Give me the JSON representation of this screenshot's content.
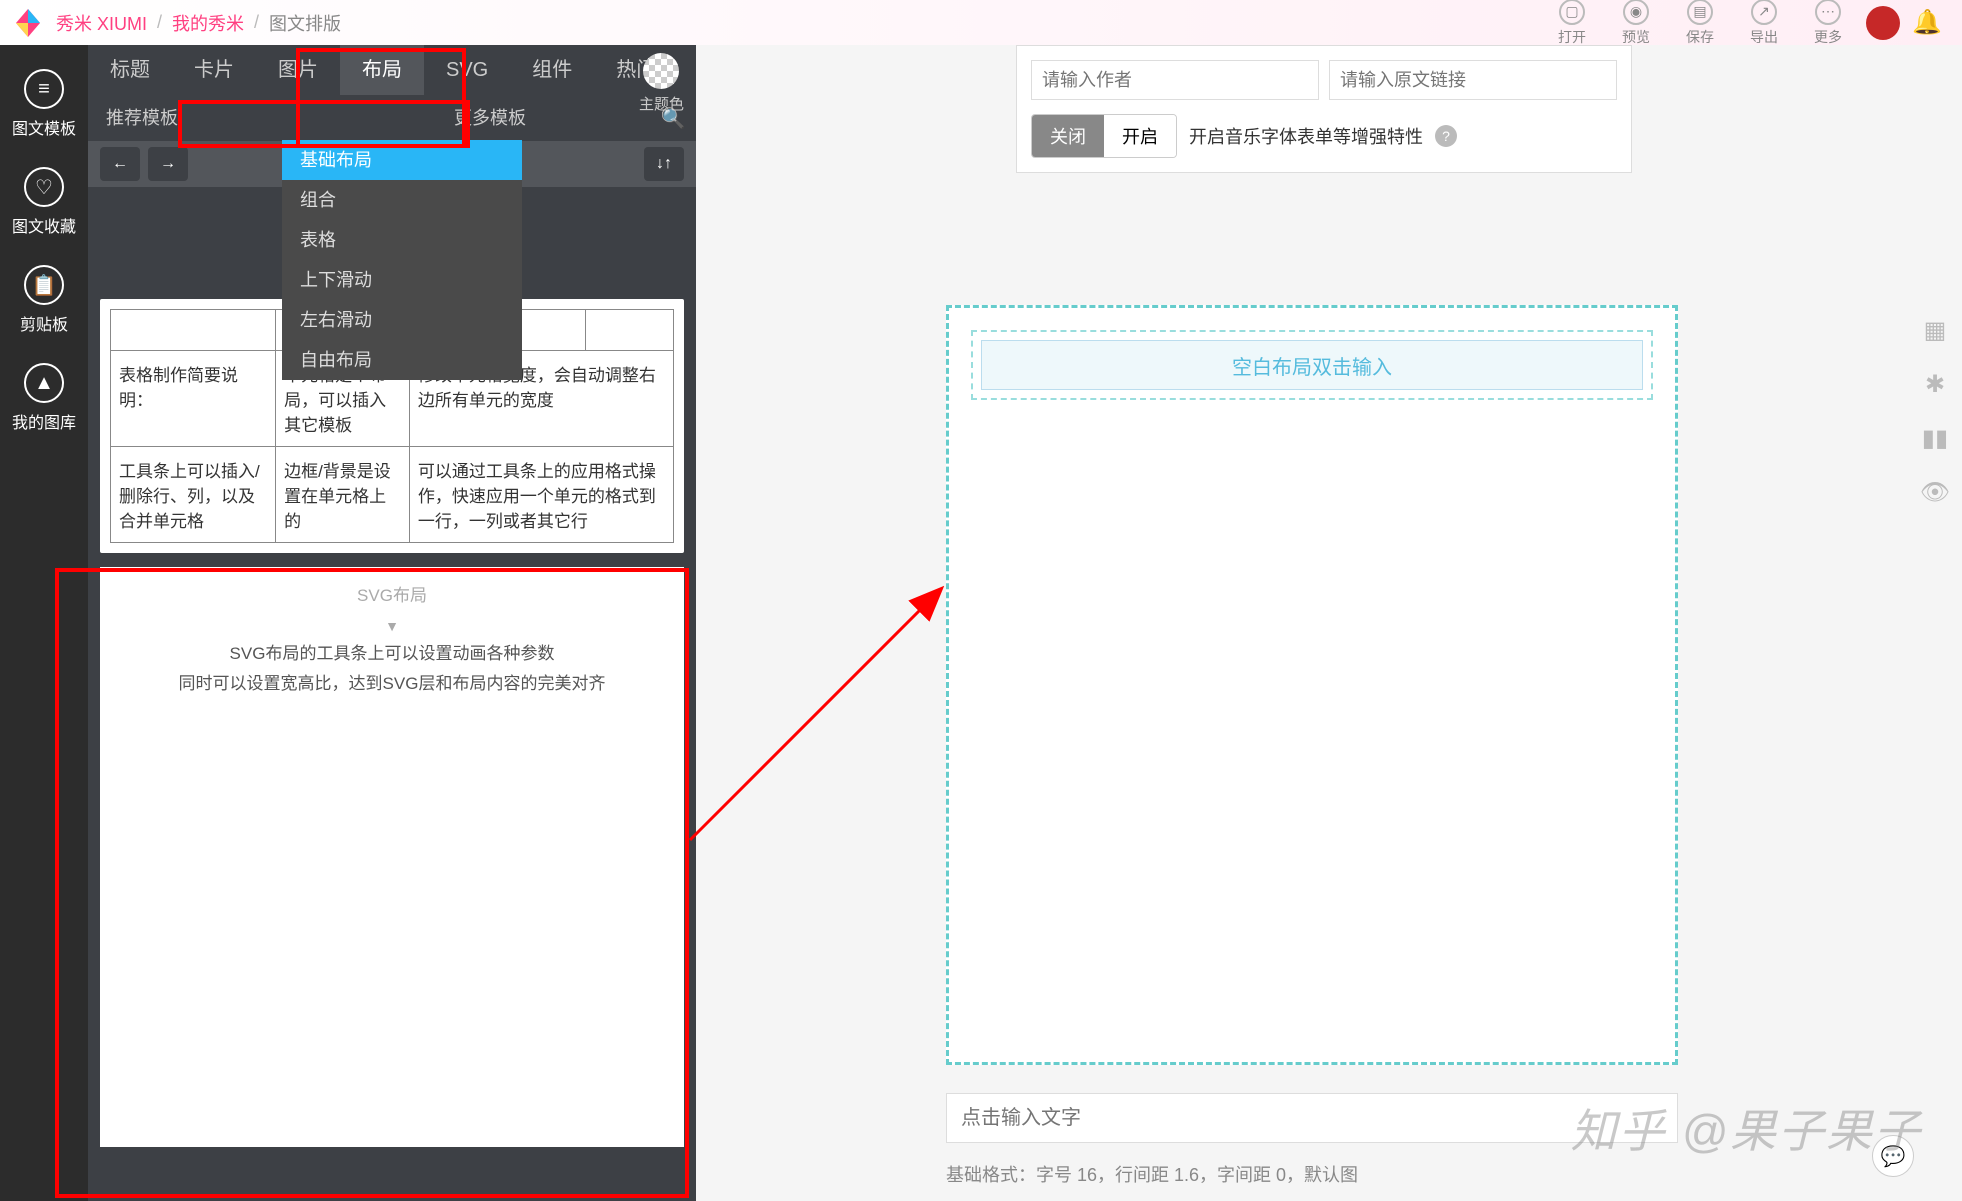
{
  "breadcrumb": {
    "brand": "秀米 XIUMI",
    "mine": "我的秀米",
    "page": "图文排版"
  },
  "topActions": {
    "open": "打开",
    "preview": "预览",
    "save": "保存",
    "export": "导出",
    "more": "更多"
  },
  "sidebar": {
    "templates": "图文模板",
    "favorites": "图文收藏",
    "clipboard": "剪贴板",
    "gallery": "我的图库"
  },
  "tabs": {
    "title": "标题",
    "card": "卡片",
    "image": "图片",
    "layout": "布局",
    "svg": "SVG",
    "component": "组件",
    "hot": "热门"
  },
  "themeColor": "主题色",
  "subTabs": {
    "recommend": "推荐模板",
    "more": "更多模板"
  },
  "toolbar": {
    "swap": "换一换"
  },
  "dropdown": {
    "basic": "基础布局",
    "combo": "组合",
    "table": "表格",
    "vscroll": "上下滑动",
    "hscroll": "左右滑动",
    "free": "自由布局"
  },
  "tableSample": {
    "r1c1": "表格制作简要说明：",
    "r1c2": "单元格是个布局，可以插入其它模板",
    "r1c3": "修改单元格宽度，会自动调整右边所有单元的宽度",
    "r2c1": "工具条上可以插入/删除行、列，以及合并单元格",
    "r2c2": "边框/背景是设置在单元格上的",
    "r2c3": "可以通过工具条上的应用格式操作，快速应用一个单元的格式到一行，一列或者其它行",
    "dash": "—"
  },
  "svgCard": {
    "title": "SVG布局",
    "arrow": "▼",
    "line1": "SVG布局的工具条上可以设置动画各种参数",
    "line2": "同时可以设置宽高比，达到SVG层和布局内容的完美对齐"
  },
  "meta": {
    "authorPlaceholder": "请输入作者",
    "linkPlaceholder": "请输入原文链接",
    "close": "关闭",
    "open": "开启",
    "enhanceLabel": "开启音乐字体表单等增强特性"
  },
  "canvas": {
    "placeholder": "空白布局双击输入"
  },
  "bottom": {
    "inputPlaceholder": "点击输入文字",
    "status": "基础格式：字号 16，行间距 1.6，字间距 0，默认图"
  },
  "watermark": "知乎 @果子果子"
}
